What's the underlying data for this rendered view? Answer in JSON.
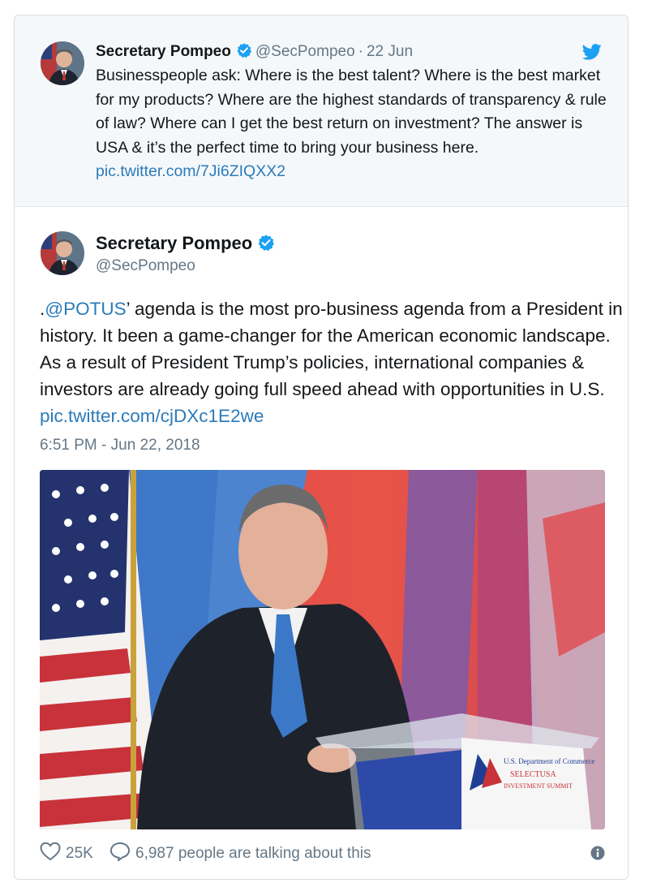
{
  "quoted_tweet": {
    "name": "Secretary Pompeo",
    "handle": "@SecPompeo",
    "separator": "·",
    "date": "22 Jun",
    "text": "Businesspeople ask: Where is the best talent? Where is the best market for my products? Where are the highest standards of transparency & rule of law? Where can I get the best return on investment? The answer is USA & it’s the perfect time to bring your business here.",
    "link": "pic.twitter.com/7Ji6ZIQXX2"
  },
  "main_tweet": {
    "name": "Secretary Pompeo",
    "handle": "@SecPompeo",
    "text_prefix": ".",
    "mention": "@POTUS",
    "text": "’ agenda is the most pro-business agenda from a President in history. It been a game-changer for the American economic landscape. As a result of President Trump’s policies, international companies & investors are already going full speed ahead with opportunities in U.S.",
    "link": "pic.twitter.com/cjDXc1E2we",
    "timestamp": "6:51 PM - Jun 22, 2018",
    "photo": {
      "podium_line1": "U.S. Department of Commerce",
      "podium_line2": "SELECTUSA",
      "podium_line3": "INVESTMENT SUMMIT"
    }
  },
  "actions": {
    "likes": "25K",
    "talking": "6,987 people are talking about this"
  },
  "icons": {
    "verified": "verified-badge-icon",
    "bird": "twitter-bird-icon",
    "like": "heart-icon",
    "reply": "speech-bubble-icon",
    "info": "info-icon"
  },
  "colors": {
    "link": "#2b7bb9",
    "verified": "#1da1f2",
    "muted": "#657786",
    "quoted_background": "#f5f8fa"
  }
}
